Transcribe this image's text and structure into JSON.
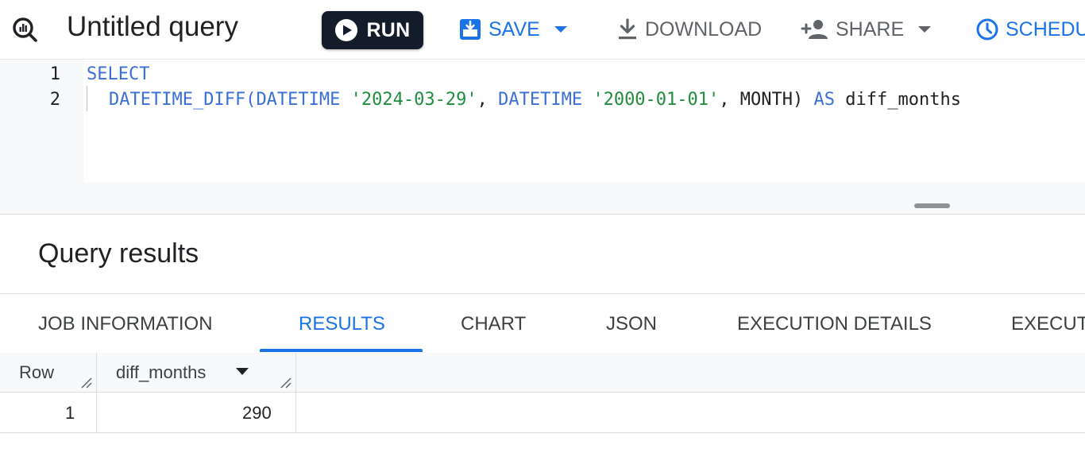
{
  "toolbar": {
    "query_icon": "query-editor-icon",
    "title": "Untitled query",
    "run_label": "RUN",
    "save_label": "SAVE",
    "download_label": "DOWNLOAD",
    "share_label": "SHARE",
    "schedule_label": "SCHEDU"
  },
  "editor": {
    "line_numbers": [
      "1",
      "2"
    ],
    "line1": {
      "keyword": "SELECT"
    },
    "line2": {
      "fn": "DATETIME_DIFF(",
      "kw1": "DATETIME",
      "str1": "'2024-03-29'",
      "sep": ", ",
      "kw2": "DATETIME",
      "str2": "'2000-01-01'",
      "arg": ", MONTH) ",
      "as_kw": "AS",
      "alias": " diff_months"
    }
  },
  "results": {
    "title": "Query results",
    "tabs": [
      {
        "label": "JOB INFORMATION"
      },
      {
        "label": "RESULTS",
        "active": true
      },
      {
        "label": "CHART"
      },
      {
        "label": "JSON"
      },
      {
        "label": "EXECUTION DETAILS"
      },
      {
        "label": "EXECUT"
      }
    ],
    "table": {
      "columns": [
        "Row",
        "diff_months"
      ],
      "rows": [
        {
          "row": "1",
          "diff_months": "290"
        }
      ]
    }
  },
  "colors": {
    "accent": "#1a73e8",
    "run_button": "#121c2b",
    "keyword": "#3a6fd8",
    "string": "#1e8e3e"
  }
}
